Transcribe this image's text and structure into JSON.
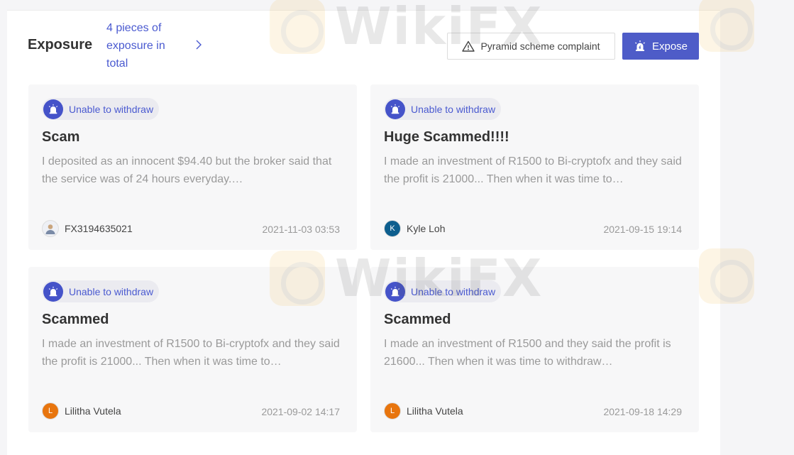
{
  "header": {
    "title": "Exposure",
    "count_text": "4 pieces of exposure in total",
    "complaint_button": "Pyramid scheme complaint",
    "expose_button": "Expose"
  },
  "watermark": "WikiFX",
  "cards": [
    {
      "tag": "Unable to withdraw",
      "title": "Scam",
      "body": "I deposited as an innocent $94.40 but the broker said that the service was of 24 hours everyday.…",
      "author": "FX3194635021",
      "avatar_initial": "",
      "date": "2021-11-03 03:53"
    },
    {
      "tag": "Unable to withdraw",
      "title": "Huge Scammed!!!!",
      "body": "I made an investment of R1500 to Bi-cryptofx and they said the profit is 21000... Then when it was time to…",
      "author": "Kyle Loh",
      "avatar_initial": "K",
      "date": "2021-09-15 19:14"
    },
    {
      "tag": "Unable to withdraw",
      "title": "Scammed",
      "body": "I made an investment of R1500 to Bi-cryptofx and they said the profit is 21000... Then when it was time to…",
      "author": "Lilitha Vutela",
      "avatar_initial": "L",
      "date": "2021-09-02 14:17"
    },
    {
      "tag": "Unable to withdraw",
      "title": "Scammed",
      "body": "I made an investment of R1500 and they said the profit is 21600... Then when it was time to withdraw…",
      "author": "Lilitha Vutela",
      "avatar_initial": "L",
      "date": "2021-09-18 14:29"
    }
  ],
  "colors": {
    "accent": "#4e5cc8",
    "link": "#4a5ad0",
    "muted_text": "#9a9a9a",
    "card_bg": "#f7f7f8"
  }
}
